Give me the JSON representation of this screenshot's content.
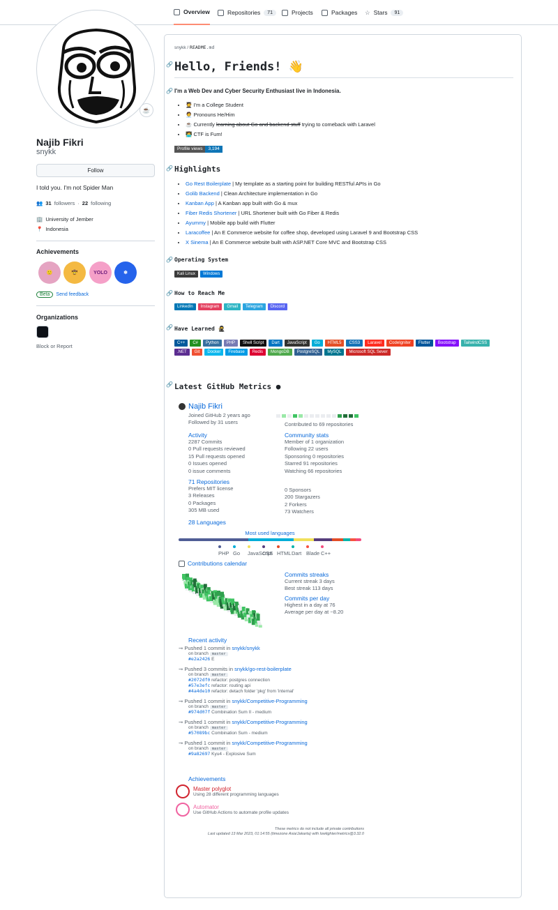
{
  "nav": {
    "tabs": [
      {
        "label": "Overview",
        "count": ""
      },
      {
        "label": "Repositories",
        "count": "71"
      },
      {
        "label": "Projects",
        "count": ""
      },
      {
        "label": "Packages",
        "count": ""
      },
      {
        "label": "Stars",
        "count": "91"
      }
    ]
  },
  "profile": {
    "status_emoji": "☕",
    "name": "Najib Fikri",
    "login": "snykk",
    "follow_label": "Follow",
    "bio": "I told you. I'm not Spider Man",
    "followers_count": "31",
    "followers_label": "followers",
    "separator": "·",
    "following_count": "22",
    "following_label": "following",
    "org": "University of Jember",
    "location": "Indonesia",
    "achievements_heading": "Achievements",
    "achievement_badges": [
      {
        "color": "#e5a4c2",
        "label": "🙂"
      },
      {
        "color": "#f4b942",
        "label": "🤠"
      },
      {
        "color": "#f5a0c8",
        "label": "YOLO"
      },
      {
        "color": "#2563eb",
        "label": "❄"
      }
    ],
    "beta_label": "Beta",
    "feedback_label": "Send feedback",
    "organizations_heading": "Organizations",
    "block_label": "Block or Report"
  },
  "readme": {
    "crumb_user": "snykk",
    "crumb_sep": " / ",
    "crumb_file": "README",
    "crumb_ext": ".md",
    "title": "Hello, Friends! 👋",
    "intro": "I'm a Web Dev and Cyber Security Enthusiast live in Indonesia.",
    "about": [
      {
        "icon": "🧑‍🎓",
        "pre": "I'm a College Student",
        "strike": "",
        "post": ""
      },
      {
        "icon": "🧑‍💼",
        "pre": "Pronouns He/Him",
        "strike": "",
        "post": ""
      },
      {
        "icon": "☕",
        "pre": "Currently ",
        "strike": "learning about Go and backend stuff",
        "post": " trying to comeback with Laravel"
      },
      {
        "icon": "🧑‍💻",
        "pre": "CTF is Fum!",
        "strike": "",
        "post": ""
      }
    ],
    "profile_views_label": "Profile views",
    "profile_views_value": "3,194",
    "highlights_heading": "Highlights",
    "highlights": [
      {
        "name": "Go Rest Boilerplate",
        "desc": " | My template as a starting point for building RESTful APIs in Go"
      },
      {
        "name": "Golib Backend",
        "desc": " | Clean Architecture implementation in Go"
      },
      {
        "name": "Kanban App",
        "desc": " | A Kanban app built with Go & mux"
      },
      {
        "name": "Fiber Redis Shortener",
        "desc": " | URL Shortener built with Go Fiber & Redis"
      },
      {
        "name": "Ayummy",
        "desc": " | Mobile app build with Flutter"
      },
      {
        "name": "Laracoffee",
        "desc": " | An E Commerce website for coffee shop, developed using Laravel 9 and Bootstrap CSS"
      },
      {
        "name": "X Sinema",
        "desc": " | An E Commerce website built with ASP.NET Core MVC and Bootstrap CSS"
      }
    ],
    "os_heading": "Operating System",
    "os_badges": [
      {
        "label": "Kali Linux",
        "color": "#3b3b3b"
      },
      {
        "label": "Windows",
        "color": "#0078d6"
      }
    ],
    "reach_heading": "How to Reach Me",
    "reach_badges": [
      {
        "label": "LinkedIn",
        "color": "#0077b5"
      },
      {
        "label": "Instagram",
        "color": "#e4405f"
      },
      {
        "label": "Gmail",
        "color": "#2db5c4"
      },
      {
        "label": "Telegram",
        "color": "#2ca5e0"
      },
      {
        "label": "Discord",
        "color": "#5865f2"
      }
    ],
    "learned_heading": "Have Learned",
    "learned_badges": [
      {
        "label": "C++",
        "color": "#00599c"
      },
      {
        "label": "C#",
        "color": "#239120"
      },
      {
        "label": "Python",
        "color": "#3670a0"
      },
      {
        "label": "PHP",
        "color": "#777bb4"
      },
      {
        "label": "Shell Script",
        "color": "#121011"
      },
      {
        "label": "Dart",
        "color": "#0175c2"
      },
      {
        "label": "JavaScript",
        "color": "#323330"
      },
      {
        "label": "Go",
        "color": "#00add8"
      },
      {
        "label": "HTML5",
        "color": "#e34f26"
      },
      {
        "label": "CSS3",
        "color": "#1572b6"
      },
      {
        "label": "Laravel",
        "color": "#ff2d20"
      },
      {
        "label": "CodeIgniter",
        "color": "#ef4223"
      },
      {
        "label": "Flutter",
        "color": "#02569b"
      },
      {
        "label": "Bootstrap",
        "color": "#8511fa"
      },
      {
        "label": "TailwindCSS",
        "color": "#38b2ac"
      },
      {
        "label": ".NET",
        "color": "#5c2d91"
      },
      {
        "label": "Git",
        "color": "#f05033"
      },
      {
        "label": "Docker",
        "color": "#0db7ed"
      },
      {
        "label": "Firebase",
        "color": "#039be5"
      },
      {
        "label": "Redis",
        "color": "#dd0031"
      },
      {
        "label": "MongoDB",
        "color": "#4ea94b"
      },
      {
        "label": "PostgreSQL",
        "color": "#316192"
      },
      {
        "label": "MySQL",
        "color": "#00758f"
      },
      {
        "label": "Microsoft SQL Sever",
        "color": "#cc2927"
      }
    ],
    "metrics_heading": "Latest GitHub Metrics"
  },
  "metrics": {
    "name": "Najib Fikri",
    "joined": "Joined GitHub 2 years ago",
    "followed": "Followed by 31 users",
    "contributed": "Contributed to 69 repositories",
    "calendar_cells": [
      "#ebedf0",
      "#9be9a8",
      "#ebedf0",
      "#40c463",
      "#9be9a8",
      "#ebedf0",
      "#ebedf0",
      "#ebedf0",
      "#ebedf0",
      "#ebedf0",
      "#ebedf0",
      "#30a14e",
      "#216e39",
      "#216e39",
      "#40c463"
    ],
    "activity_title": "Activity",
    "activity": [
      "2287 Commits",
      "0 Pull requests reviewed",
      "15 Pull requests opened",
      "0 Issues opened",
      "0 issue comments"
    ],
    "community_title": "Community stats",
    "community": [
      "Member of 1 organization",
      "Following 22 users",
      "Sponsoring 0 repositories",
      "Starred 91 repositories",
      "Watching 66 repositories"
    ],
    "repos_title": "71 Repositories",
    "repos": [
      "Prefers MIT license",
      "3 Releases",
      "0 Packages",
      "305 MB used"
    ],
    "repos_right": [
      "0 Sponsors",
      "200 Stargazers",
      "2 Forkers",
      "73 Watchers"
    ],
    "languages_title": "28 Languages",
    "most_used": "Most used languages",
    "languages": [
      {
        "name": "PHP",
        "color": "#4F5D95",
        "share": 0.38
      },
      {
        "name": "Go",
        "color": "#00ADD8",
        "share": 0.25
      },
      {
        "name": "JavaScript",
        "color": "#f1e05a",
        "share": 0.11
      },
      {
        "name": "CSS",
        "color": "#563d7c",
        "share": 0.1
      },
      {
        "name": "HTML",
        "color": "#e34c26",
        "share": 0.06
      },
      {
        "name": "Dart",
        "color": "#00B4AB",
        "share": 0.04
      },
      {
        "name": "Blade",
        "color": "#f7523f",
        "share": 0.03
      },
      {
        "name": "C++",
        "color": "#f34b7d",
        "share": 0.03
      }
    ],
    "calendar_title": "Contributions calendar",
    "streaks_title": "Commits streaks",
    "current_streak": "Current streak 3 days",
    "best_streak": "Best streak 113 days",
    "perday_title": "Commits per day",
    "highest": "Highest in a day at 76",
    "average": "Average per day at ~8.20",
    "recent_title": "Recent activity",
    "recent": [
      {
        "pre": "Pushed 1 commit in ",
        "repo": "snykk/snykk",
        "branch": "master",
        "commits": [
          {
            "sha": "#e2a2426",
            "msg": "E"
          }
        ]
      },
      {
        "pre": "Pushed 3 commits in ",
        "repo": "snykk/go-rest-boilerplate",
        "branch": "master",
        "commits": [
          {
            "sha": "#2072df0",
            "msg": "refactor: postgres connection"
          },
          {
            "sha": "#57e3efc",
            "msg": "refactor: routing api"
          },
          {
            "sha": "#4a4de10",
            "msg": "refactor: detach folder 'pkg' from 'internal'"
          }
        ]
      },
      {
        "pre": "Pushed 1 commit in ",
        "repo": "snykk/Competitive-Programming",
        "branch": "master",
        "commits": [
          {
            "sha": "#974d07f",
            "msg": "Combination Sum II - medium"
          }
        ]
      },
      {
        "pre": "Pushed 1 commit in ",
        "repo": "snykk/Competitive-Programming",
        "branch": "master",
        "commits": [
          {
            "sha": "#57089bc",
            "msg": "Combination Sum - medium"
          }
        ]
      },
      {
        "pre": "Pushed 1 commit in ",
        "repo": "snykk/Competitive-Programming",
        "branch": "master",
        "commits": [
          {
            "sha": "#9a82697",
            "msg": "Kyu4 - Explosive Sum"
          }
        ]
      }
    ],
    "on_branch": "on branch",
    "achievements_title": "Achievements",
    "achievements": [
      {
        "name": "Master polyglot",
        "desc": "Using 28 different programming languages",
        "color": "#d1242f"
      },
      {
        "name": "Automator",
        "desc": "Use GitHub Actions to automate profile updates",
        "color": "#f062a0"
      }
    ],
    "footer1": "These metrics do not include all private contributions",
    "footer2": "Last updated 13 Mar 2023, 01:14:55 (timezone Asia/Jakarta) with lowlighter/metrics@3.32.0"
  }
}
